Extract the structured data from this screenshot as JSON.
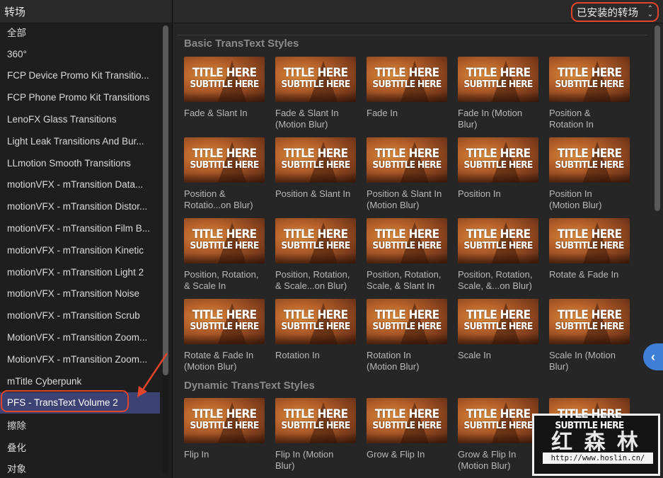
{
  "sidebar": {
    "title": "转场",
    "items": [
      {
        "label": "全部"
      },
      {
        "label": "360°"
      },
      {
        "label": "FCP Device Promo Kit Transitio..."
      },
      {
        "label": "FCP Phone Promo Kit Transitions"
      },
      {
        "label": "LenoFX Glass Transitions"
      },
      {
        "label": "Light Leak Transitions And Bur..."
      },
      {
        "label": "LLmotion Smooth Transitions"
      },
      {
        "label": "motionVFX - mTransition Data..."
      },
      {
        "label": "motionVFX - mTransition Distor..."
      },
      {
        "label": "motionVFX - mTransition Film B..."
      },
      {
        "label": "motionVFX - mTransition Kinetic"
      },
      {
        "label": "motionVFX - mTransition Light 2"
      },
      {
        "label": "motionVFX - mTransition Noise"
      },
      {
        "label": "motionVFX - mTransition Scrub"
      },
      {
        "label": "MotionVFX - mTransition Zoom..."
      },
      {
        "label": "MotionVFX - mTransition Zoom..."
      },
      {
        "label": "mTitle Cyberpunk"
      },
      {
        "label": "PFS - TransText Volume 2"
      },
      {
        "label": "擦除"
      },
      {
        "label": "叠化"
      },
      {
        "label": "对象"
      }
    ],
    "selected_index": 17
  },
  "header": {
    "dropdown_label": "已安装的转场"
  },
  "thumb_text": {
    "title": "TITLE HERE",
    "subtitle": "SUBTITLE HERE"
  },
  "sections": [
    {
      "title": "Basic TransText Styles",
      "tiles": [
        {
          "label": "Fade & Slant In"
        },
        {
          "label": "Fade & Slant In\n(Motion Blur)"
        },
        {
          "label": "Fade In"
        },
        {
          "label": "Fade In (Motion\nBlur)"
        },
        {
          "label": "Position &\nRotation In"
        },
        {
          "label": "Position &\nRotatio...on Blur)"
        },
        {
          "label": "Position & Slant In"
        },
        {
          "label": "Position & Slant In\n(Motion Blur)"
        },
        {
          "label": "Position In"
        },
        {
          "label": "Position In\n(Motion Blur)"
        },
        {
          "label": "Position, Rotation,\n& Scale In"
        },
        {
          "label": "Position, Rotation,\n& Scale...on Blur)"
        },
        {
          "label": "Position, Rotation,\nScale, & Slant In"
        },
        {
          "label": "Position, Rotation,\nScale, &...on Blur)"
        },
        {
          "label": "Rotate & Fade In"
        },
        {
          "label": "Rotate & Fade In\n(Motion Blur)"
        },
        {
          "label": "Rotation In"
        },
        {
          "label": "Rotation In\n(Motion Blur)"
        },
        {
          "label": "Scale In"
        },
        {
          "label": "Scale In (Motion\nBlur)"
        }
      ]
    },
    {
      "title": "Dynamic TransText Styles",
      "tiles": [
        {
          "label": "Flip In"
        },
        {
          "label": "Flip In (Motion\nBlur)"
        },
        {
          "label": "Grow & Flip In"
        },
        {
          "label": "Grow & Flip In\n(Motion Blur)"
        },
        {
          "label": ""
        }
      ]
    }
  ],
  "watermark": {
    "text": "红 森 林",
    "url": "http://www.hoslin.cn/"
  },
  "colors": {
    "accent_ring": "#e0442b",
    "selection": "#3d4275",
    "side_tab": "#3f7fd8"
  },
  "icons": [
    "updown-chevron-icon",
    "chevron-left-icon",
    "annotation-arrow"
  ]
}
